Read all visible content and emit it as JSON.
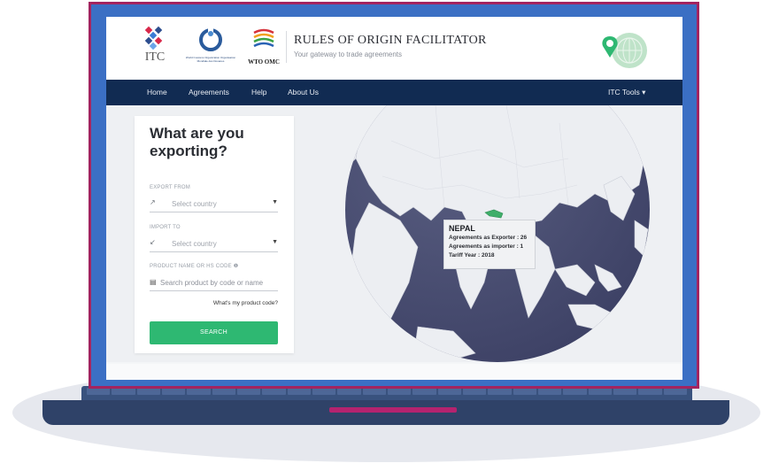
{
  "brand": {
    "itc_label": "ITC",
    "wco_label": "World Customs Organization Organisation Mondiale des Douanes",
    "wto_label": "WTO OMC",
    "title": "RULES OF ORIGIN FACILITATOR",
    "subtitle": "Your gateway to trade agreements"
  },
  "nav": {
    "items": [
      "Home",
      "Agreements",
      "Help",
      "About Us"
    ],
    "tools": "ITC Tools ▾"
  },
  "search_panel": {
    "heading": "What are you exporting?",
    "export_label": "EXPORT FROM",
    "export_placeholder": "Select country",
    "import_label": "IMPORT TO",
    "import_placeholder": "Select country",
    "product_label": "PRODUCT NAME OR HS CODE ❶",
    "product_placeholder": "Search product by code or name",
    "help_link": "What's my product code?",
    "search_button": "SEARCH"
  },
  "tooltip": {
    "country": "NEPAL",
    "exporter_line": "Agreements as Exporter :  26",
    "importer_line": "Agreements as importer :  1",
    "tariff_line": "Tariff Year :  2018"
  },
  "colors": {
    "nav_bg": "#112b52",
    "accent_green": "#2eb872",
    "highlight_country": "#3fae6a",
    "frame_pink": "#a3245f",
    "bezel_blue": "#3b6fc4"
  }
}
